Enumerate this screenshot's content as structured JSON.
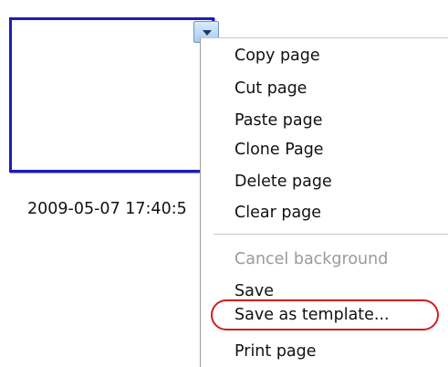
{
  "page": {
    "timestamp": "2009-05-07 17:40:5"
  },
  "page_menu": {
    "items": [
      {
        "label": "Copy page",
        "enabled": true
      },
      {
        "label": "Cut page",
        "enabled": true
      },
      {
        "label": "Paste page",
        "enabled": true
      },
      {
        "label": "Clone Page",
        "enabled": true
      },
      {
        "label": "Delete page",
        "enabled": true
      },
      {
        "label": "Clear page",
        "enabled": true
      },
      {
        "label": "Cancel background",
        "enabled": false
      },
      {
        "label": "Save",
        "enabled": true
      },
      {
        "label": "Save as template...",
        "enabled": true
      },
      {
        "label": "Print page",
        "enabled": true
      }
    ],
    "highlighted_item": "Save as template..."
  },
  "colors": {
    "thumbnail_border": "#1c1eb8",
    "highlight_ring": "#cc1f1f",
    "disabled_text": "#9a9a9a"
  }
}
